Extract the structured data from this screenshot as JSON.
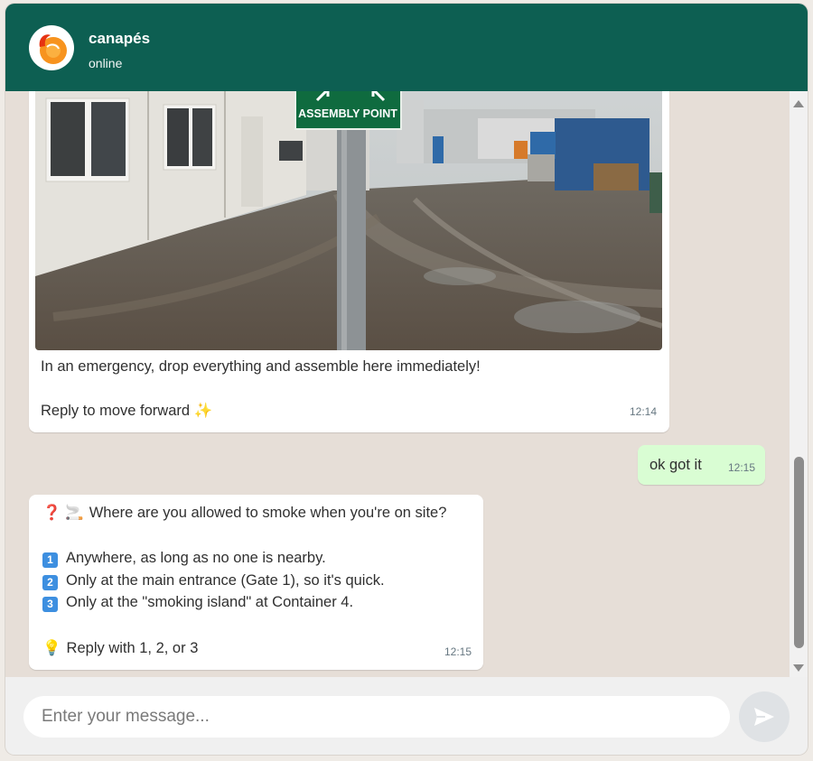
{
  "header": {
    "contact_name": "canapés",
    "status": "online"
  },
  "messages": {
    "image_message": {
      "photo_sign_text": "ASSEMBLY POINT",
      "caption_line1": "In an emergency, drop everything and assemble here immediately!",
      "caption_line2": "Reply to move forward ✨",
      "time": "12:14"
    },
    "outgoing": {
      "text": "ok got it",
      "time": "12:15"
    },
    "question": {
      "prompt_icons": "❓ 🚬",
      "prompt": "Where are you allowed to smoke when you're on site?",
      "options": [
        {
          "number": "1",
          "text": "Anywhere, as long as no one is nearby."
        },
        {
          "number": "2",
          "text": "Only at the main entrance (Gate 1), so it's quick."
        },
        {
          "number": "3",
          "text": "Only at the \"smoking island\" at Container 4."
        }
      ],
      "hint_icon": "💡",
      "hint": "Reply with 1, 2, or 3",
      "time": "12:15"
    }
  },
  "composer": {
    "placeholder": "Enter your message..."
  },
  "colors": {
    "header_bg": "#0d5f52",
    "chat_bg": "#e6ded7",
    "outgoing_bubble": "#d9fdd3",
    "number_badge": "#3d8fe0"
  },
  "icons": {
    "avatar": "canapes-logo-icon",
    "send": "send-arrow-icon"
  }
}
